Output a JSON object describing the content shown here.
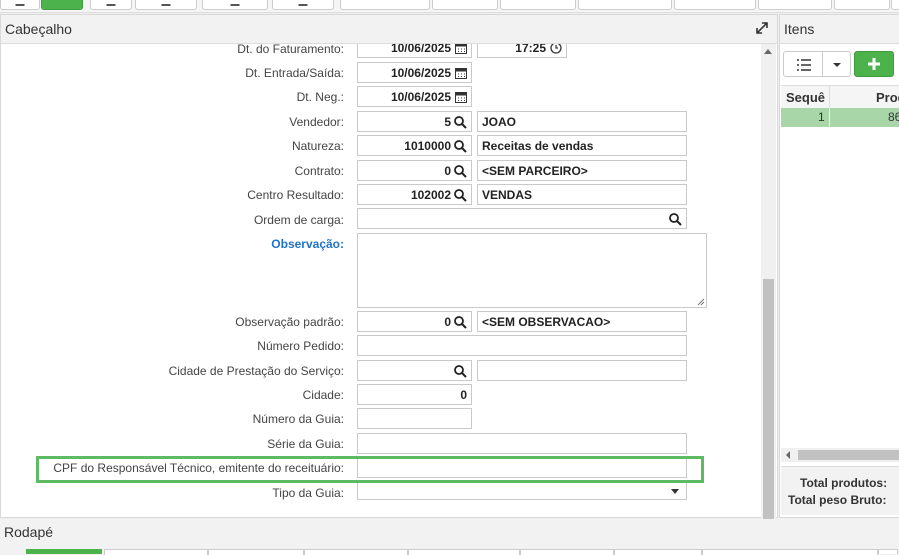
{
  "header_panel": {
    "title": "Cabeçalho"
  },
  "items_panel": {
    "title": "Itens",
    "columns": [
      "Sequê",
      "Prod"
    ],
    "row": {
      "seq": "1",
      "prod": "86"
    },
    "totals": {
      "produtos": "Total produtos:",
      "peso": "Total peso Bruto:"
    }
  },
  "footer": {
    "title": "Rodapé"
  },
  "form": {
    "dt_faturamento": {
      "label": "Dt. do Faturamento:",
      "date": "10/06/2025",
      "time": "17:25"
    },
    "dt_entrada": {
      "label": "Dt. Entrada/Saída:",
      "value": "10/06/2025"
    },
    "dt_neg": {
      "label": "Dt. Neg.:",
      "value": "10/06/2025"
    },
    "vendedor": {
      "label": "Vendedor:",
      "code": "5",
      "desc": "JOAO"
    },
    "natureza": {
      "label": "Natureza:",
      "code": "1010000",
      "desc": "Receitas de vendas"
    },
    "contrato": {
      "label": "Contrato:",
      "code": "0",
      "desc": "<SEM PARCEIRO>"
    },
    "centro": {
      "label": "Centro Resultado:",
      "code": "102002",
      "desc": "VENDAS"
    },
    "ordem": {
      "label": "Ordem de carga:",
      "value": ""
    },
    "observacao": {
      "label": "Observação:",
      "value": ""
    },
    "obs_padrao": {
      "label": "Observação padrão:",
      "code": "0",
      "desc": "<SEM OBSERVACAO>"
    },
    "num_pedido": {
      "label": "Número Pedido:",
      "value": ""
    },
    "cidade_servico": {
      "label": "Cidade de Prestação do Serviço:",
      "code": "",
      "desc": ""
    },
    "cidade": {
      "label": "Cidade:",
      "value": "0"
    },
    "num_guia": {
      "label": "Número da Guia:",
      "value": ""
    },
    "serie_guia": {
      "label": "Série da Guia:",
      "value": ""
    },
    "cpf_resp": {
      "label": "CPF do Responsável Técnico, emitente do receituário:",
      "value": ""
    },
    "tipo_guia": {
      "label": "Tipo da Guia:",
      "value": ""
    }
  }
}
